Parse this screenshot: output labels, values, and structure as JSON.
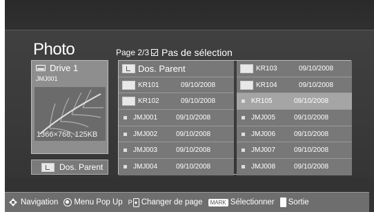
{
  "title": "Photo",
  "page_info": {
    "label": "Page 2/3",
    "selection": "Pas de sélection"
  },
  "preview": {
    "drive": "Drive 1",
    "file": "JMJ001",
    "resolution": "1366×768, 125KB"
  },
  "parent_button": "Dos. Parent",
  "files": {
    "left": [
      {
        "type": "parent",
        "name": "Dos. Parent",
        "date": ""
      },
      {
        "type": "folder",
        "name": "KR101",
        "date": "09/10/2008"
      },
      {
        "type": "folder",
        "name": "KR102",
        "date": "09/10/2008"
      },
      {
        "type": "file",
        "name": "JMJ001",
        "date": "09/10/2008"
      },
      {
        "type": "file",
        "name": "JMJ002",
        "date": "09/10/2008"
      },
      {
        "type": "file",
        "name": "JMJ003",
        "date": "09/10/2008"
      },
      {
        "type": "file",
        "name": "JMJ004",
        "date": "09/10/2008"
      }
    ],
    "right": [
      {
        "type": "folder",
        "name": "KR103",
        "date": "09/10/2008"
      },
      {
        "type": "folder",
        "name": "KR104",
        "date": "09/10/2008"
      },
      {
        "type": "file",
        "name": "KR105",
        "date": "09/10/2008",
        "selected": true
      },
      {
        "type": "file",
        "name": "JMJ005",
        "date": "09/10/2008"
      },
      {
        "type": "file",
        "name": "JMJ006",
        "date": "09/10/2008"
      },
      {
        "type": "file",
        "name": "JMJ007",
        "date": "09/10/2008"
      },
      {
        "type": "file",
        "name": "JMJ008",
        "date": "09/10/2008"
      }
    ]
  },
  "footer": {
    "navigation": "Navigation",
    "menu": "Menu Pop Up",
    "page_key": "P",
    "change_page": "Changer de page",
    "mark_key": "MARK",
    "select": "Sélectionner",
    "exit": "Sortie"
  }
}
